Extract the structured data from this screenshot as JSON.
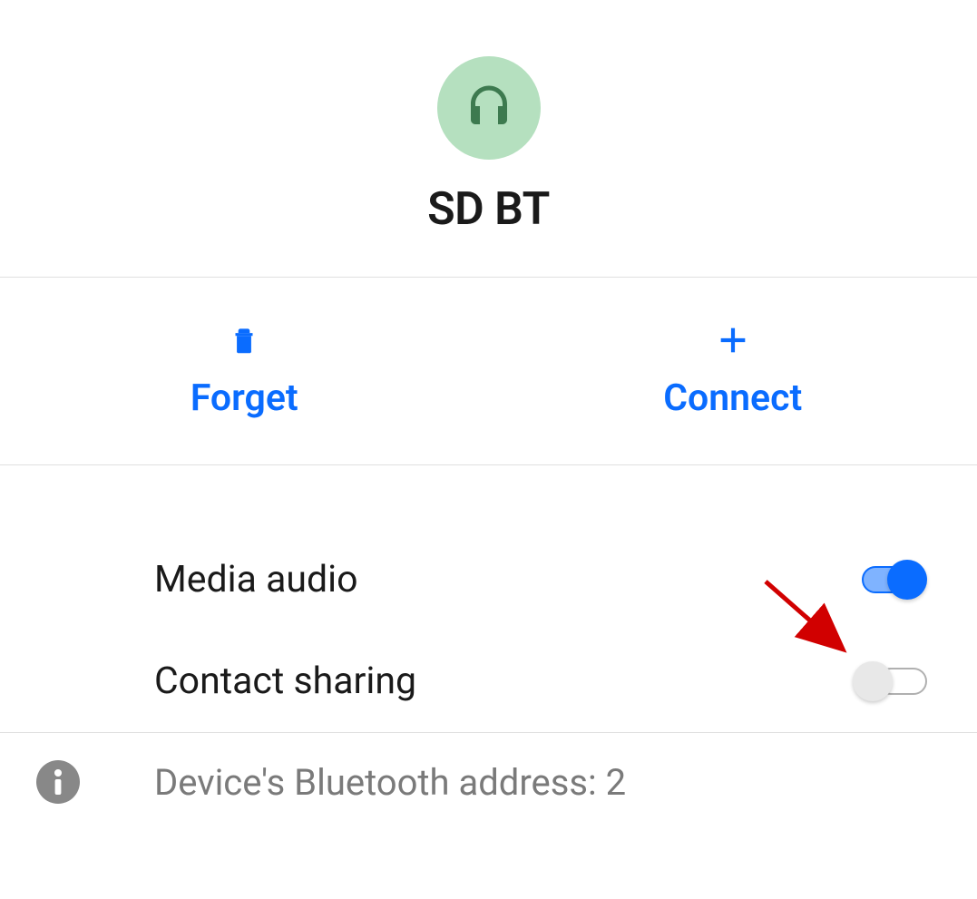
{
  "device": {
    "name": "SD BT",
    "icon": "headphones-icon"
  },
  "actions": {
    "forget": {
      "label": "Forget",
      "icon": "trash-icon"
    },
    "connect": {
      "label": "Connect",
      "icon": "plus-icon"
    }
  },
  "settings": {
    "media_audio": {
      "label": "Media audio",
      "enabled": true
    },
    "contact_sharing": {
      "label": "Contact sharing",
      "enabled": false
    }
  },
  "info": {
    "address_label": "Device's Bluetooth address: 2"
  },
  "colors": {
    "accent": "#0a6cff",
    "avatar_bg": "#b5e0bf",
    "avatar_icon": "#3d7a4f",
    "annotation": "#d10000"
  }
}
